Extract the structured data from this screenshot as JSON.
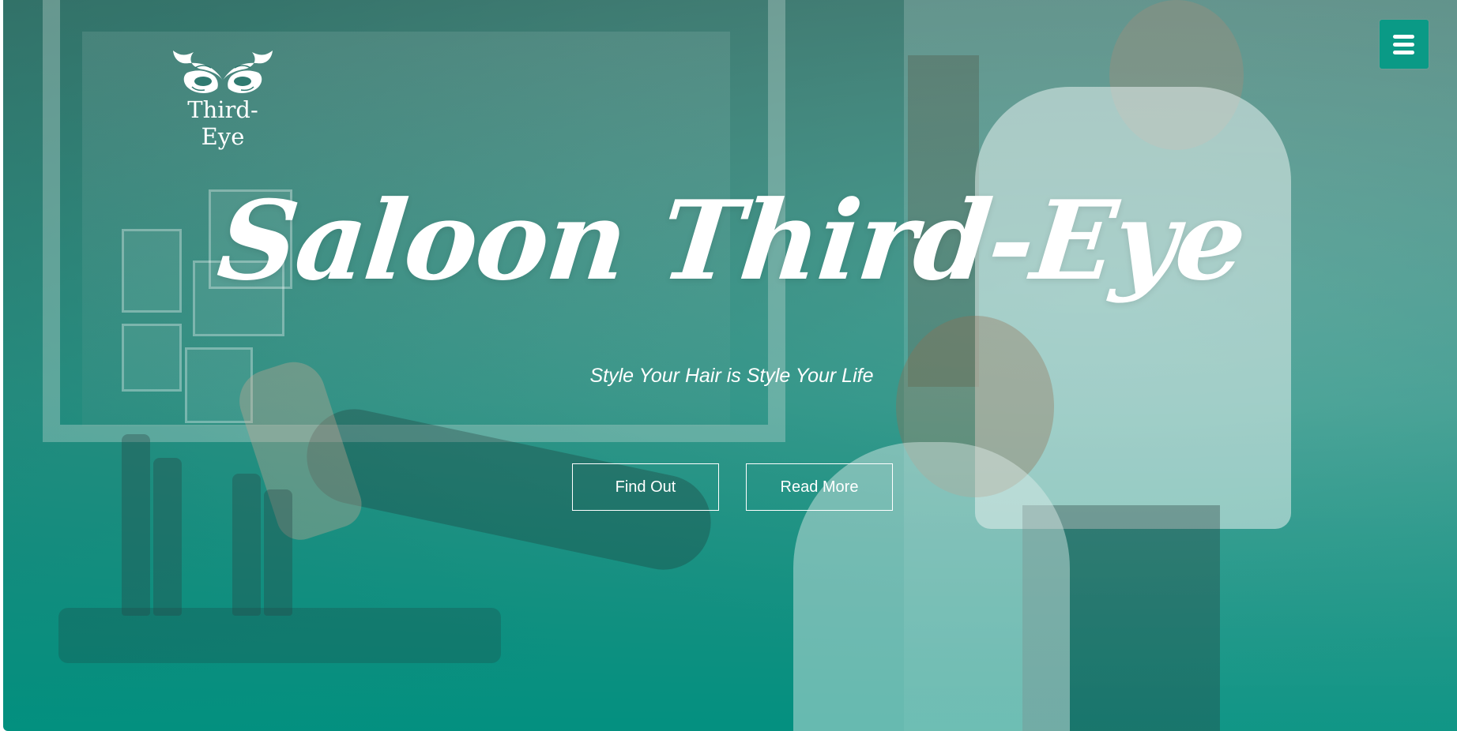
{
  "header": {
    "logo_text": "Third-Eye",
    "logo_icon": "mask-icon",
    "menu_icon": "hamburger-menu-icon"
  },
  "hero": {
    "title": "Saloon Third-Eye",
    "tagline": "Style Your Hair is Style Your Life",
    "buttons": {
      "find_out": "Find Out",
      "read_more": "Read More"
    }
  },
  "colors": {
    "accent": "#0a9a86",
    "overlay_bottom": "#00917f",
    "text": "#ffffff"
  }
}
